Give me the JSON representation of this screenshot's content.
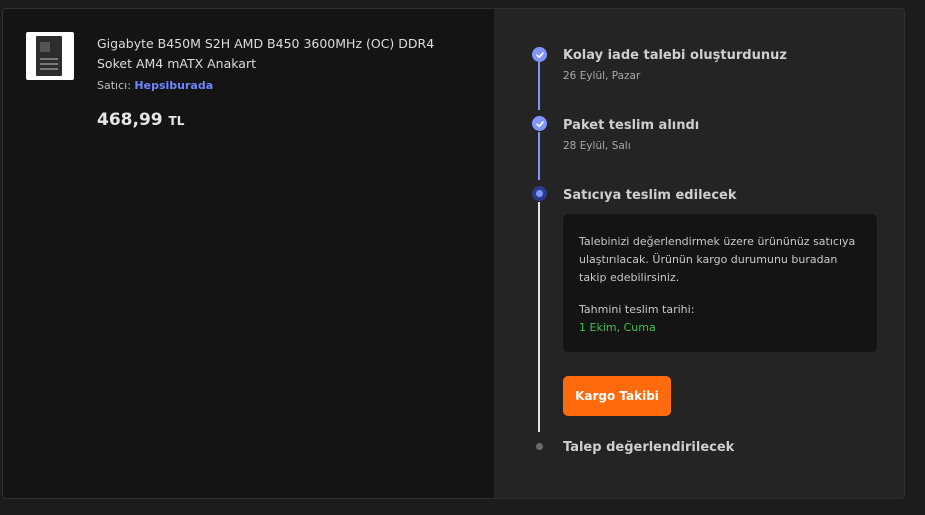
{
  "product": {
    "title": "Gigabyte B450M S2H AMD B450 3600MHz (OC) DDR4 Soket AM4 mATX Anakart",
    "seller_label": "Satıcı:",
    "seller_name": "Hepsiburada",
    "price": "468,99",
    "currency": "TL"
  },
  "timeline": {
    "steps": [
      {
        "title": "Kolay iade talebi oluşturdunuz",
        "date": "26 Eylül, Pazar",
        "status": "done"
      },
      {
        "title": "Paket teslim alındı",
        "date": "28 Eylül, Salı",
        "status": "done"
      },
      {
        "title": "Satıcıya teslim edilecek",
        "date": "",
        "status": "active"
      },
      {
        "title": "Talep değerlendirilecek",
        "date": "",
        "status": "pending"
      }
    ],
    "info": {
      "message": "Talebinizi değerlendirmek üzere ürününüz satıcıya ulaştırılacak. Ürünün kargo durumunu buradan takip edebilirsiniz.",
      "eta_label": "Tahmini teslim tarihi:",
      "eta_value": "1 Ekim, Cuma"
    },
    "button_label": "Kargo Takibi"
  },
  "colors": {
    "accent": "#8295ff",
    "button": "#ff6a0c",
    "eta": "#3ec24a",
    "seller": "#6f86ff"
  }
}
